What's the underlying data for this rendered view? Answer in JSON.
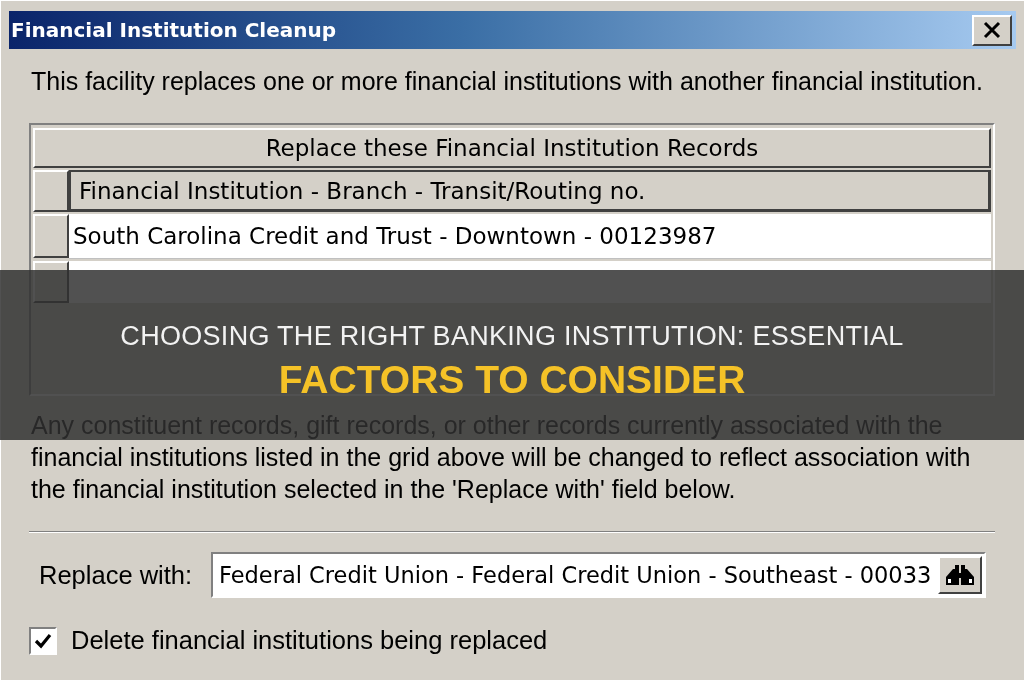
{
  "window": {
    "title": "Financial Institution Cleanup"
  },
  "description": "This facility replaces one or more financial institutions with another financial institution.",
  "grid": {
    "title": "Replace these Financial Institution Records",
    "columns": [
      "Financial Institution - Branch - Transit/Routing no."
    ],
    "rows": [
      {
        "cells": [
          "South Carolina Credit and Trust - Downtown - 00123987"
        ]
      }
    ]
  },
  "notice": "Any constituent records, gift records, or other records currently associated with the financial institutions listed in the grid above will be changed to reflect association with the financial institution selected in the 'Replace with' field below.",
  "replace_with": {
    "label": "Replace with:",
    "value": "Federal Credit Union - Federal Credit Union - Southeast - 00033"
  },
  "delete_option": {
    "label": "Delete financial institutions being replaced",
    "checked": true
  },
  "banner": {
    "lines": [
      {
        "text": "CHOOSING THE RIGHT BANKING INSTITUTION: ESSENTIAL",
        "kind": "plain"
      },
      {
        "text": "FACTORS TO CONSIDER",
        "kind": "accent"
      }
    ]
  }
}
